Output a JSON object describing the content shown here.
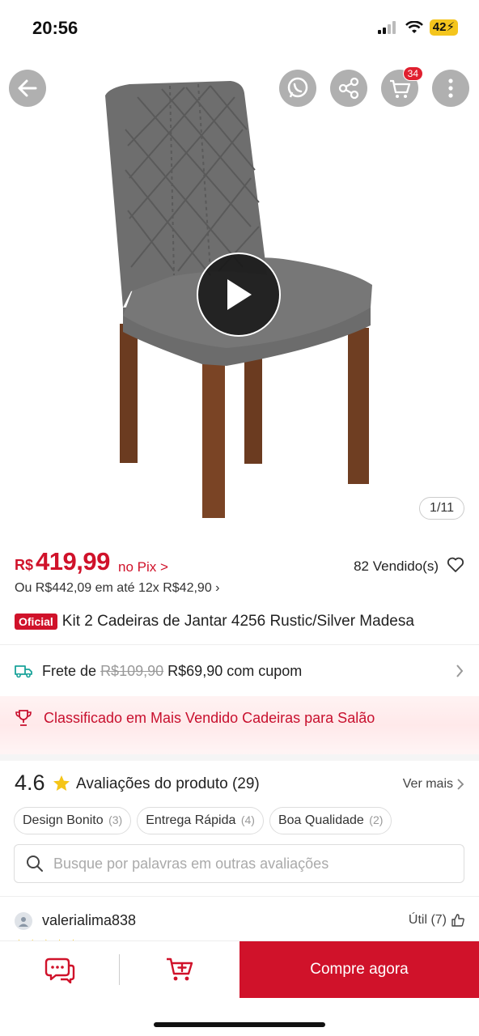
{
  "status_bar": {
    "time": "20:56",
    "battery": "42"
  },
  "product": {
    "image_counter": "1/11",
    "cart_count": "34",
    "price_currency": "R$",
    "price_value": "419,99",
    "price_suffix": "no Pix >",
    "sold": "82 Vendido(s)",
    "installments": "Ou R$442,09 em até 12x R$42,90 ›",
    "official_tag": "Oficial",
    "title": "Kit 2 Cadeiras de Jantar 4256 Rustic/Silver Madesa"
  },
  "shipping": {
    "prefix": "Frete de",
    "old_price": "R$109,90",
    "new_price": "R$69,90 com cupom"
  },
  "ranking": {
    "text": "Classificado em Mais Vendido Cadeiras para Salão"
  },
  "reviews": {
    "score": "4.6",
    "title": "Avaliações do produto",
    "count": "(29)",
    "see_more": "Ver mais",
    "tags": [
      {
        "label": "Design Bonito",
        "count": "(3)"
      },
      {
        "label": "Entrega Rápida",
        "count": "(4)"
      },
      {
        "label": "Boa Qualidade",
        "count": "(2)"
      }
    ],
    "search_placeholder": "Busque por palavras em outras avaliações",
    "first_review": {
      "user": "valerialima838",
      "useful": "Útil (7)",
      "stars": "★★★★★"
    }
  },
  "bottom_bar": {
    "buy_label": "Compre agora"
  },
  "colors": {
    "accent": "#d0122a",
    "star": "#f5c518",
    "shipping_icon": "#1aa39a"
  }
}
